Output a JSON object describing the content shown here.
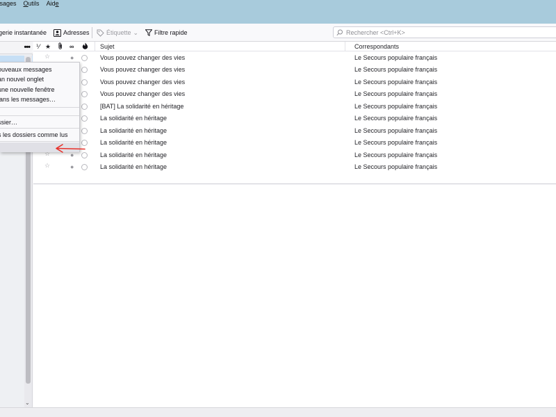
{
  "menubar": {
    "items": [
      {
        "label": "ssages",
        "underline": ""
      },
      {
        "label": "utils",
        "underline": "O"
      },
      {
        "label": "Aid",
        "underline": "e",
        "trail": true
      }
    ]
  },
  "toolbar": {
    "instant_label": "gerie instantanée",
    "address_label": "Adresses",
    "tag_label": "Étiquette",
    "filter_label": "Filtre rapide",
    "search_placeholder": "Rechercher <Ctrl+K>"
  },
  "thread": {
    "columns": {
      "subject": "Sujet",
      "correspondents": "Correspondants"
    },
    "rows": [
      {
        "subject": "Vous pouvez changer des vies",
        "correspondent": "Le Secours populaire français"
      },
      {
        "subject": "Vous pouvez changer des vies",
        "correspondent": "Le Secours populaire français"
      },
      {
        "subject": "Vous pouvez changer des vies",
        "correspondent": "Le Secours populaire français"
      },
      {
        "subject": "Vous pouvez changer des vies",
        "correspondent": "Le Secours populaire français"
      },
      {
        "subject": "[BAT] La solidarité en héritage",
        "correspondent": "Le Secours populaire français"
      },
      {
        "subject": "La solidarité en héritage",
        "correspondent": "Le Secours populaire français"
      },
      {
        "subject": "La solidarité en héritage",
        "correspondent": "Le Secours populaire français"
      },
      {
        "subject": "La solidarité en héritage",
        "correspondent": "Le Secours populaire français"
      },
      {
        "subject": "La solidarité en héritage",
        "correspondent": "Le Secours populaire français"
      },
      {
        "subject": "La solidarité en héritage",
        "correspondent": "Le Secours populaire français"
      }
    ]
  },
  "context_menu": {
    "items": [
      "ouveaux messages",
      "an nouvel onglet",
      "une nouvelle fenêtre",
      "lans les messages…",
      "ssier…",
      "s les dossiers comme lus",
      ""
    ]
  },
  "colors": {
    "menubar_bg": "#a8cbdc",
    "selection": "#c6dff5",
    "annotation_arrow": "#e8302a"
  }
}
